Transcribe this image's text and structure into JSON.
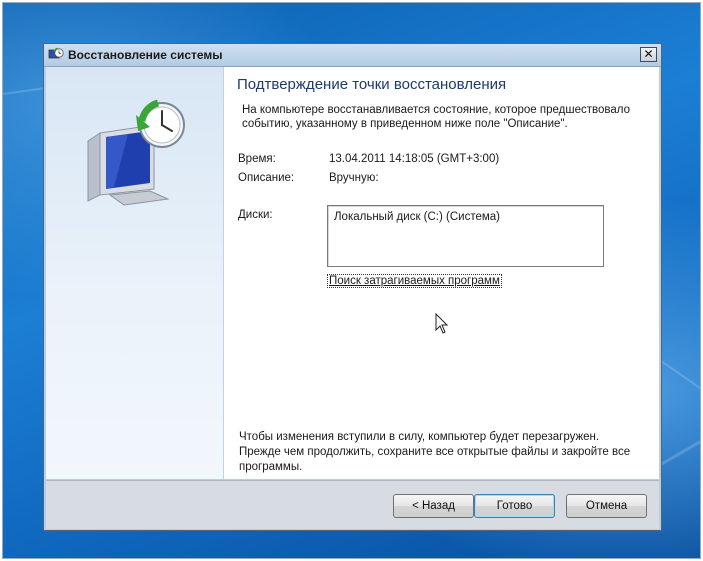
{
  "window": {
    "title": "Восстановление системы",
    "close_symbol": "✕"
  },
  "content": {
    "heading": "Подтверждение точки восстановления",
    "intro": "На компьютере восстанавливается состояние, которое предшествовало событию, указанному в приведенном ниже поле \"Описание\".",
    "time_label": "Время:",
    "time_value": "13.04.2011 14:18:05 (GMT+3:00)",
    "description_label": "Описание:",
    "description_value": "Вручную:",
    "disks_label": "Диски:",
    "disks": [
      "Локальный диск (C:) (Система)"
    ],
    "scan_link": "Поиск затрагиваемых программ",
    "footer_note": "Чтобы изменения вступили в силу, компьютер будет перезагружен. Прежде чем продолжить, сохраните все открытые файлы и закройте все программы."
  },
  "buttons": {
    "back": "< Назад",
    "finish": "Готово",
    "cancel": "Отмена"
  },
  "icons": {
    "title_icon": "system-restore-icon",
    "hero_icon": "monitor-clock-restore-icon",
    "cursor": "mouse-pointer-icon"
  },
  "colors": {
    "desktop": "#1c7fd4",
    "heading": "#1e3b6e",
    "restore_arrow": "#3aa63a"
  }
}
